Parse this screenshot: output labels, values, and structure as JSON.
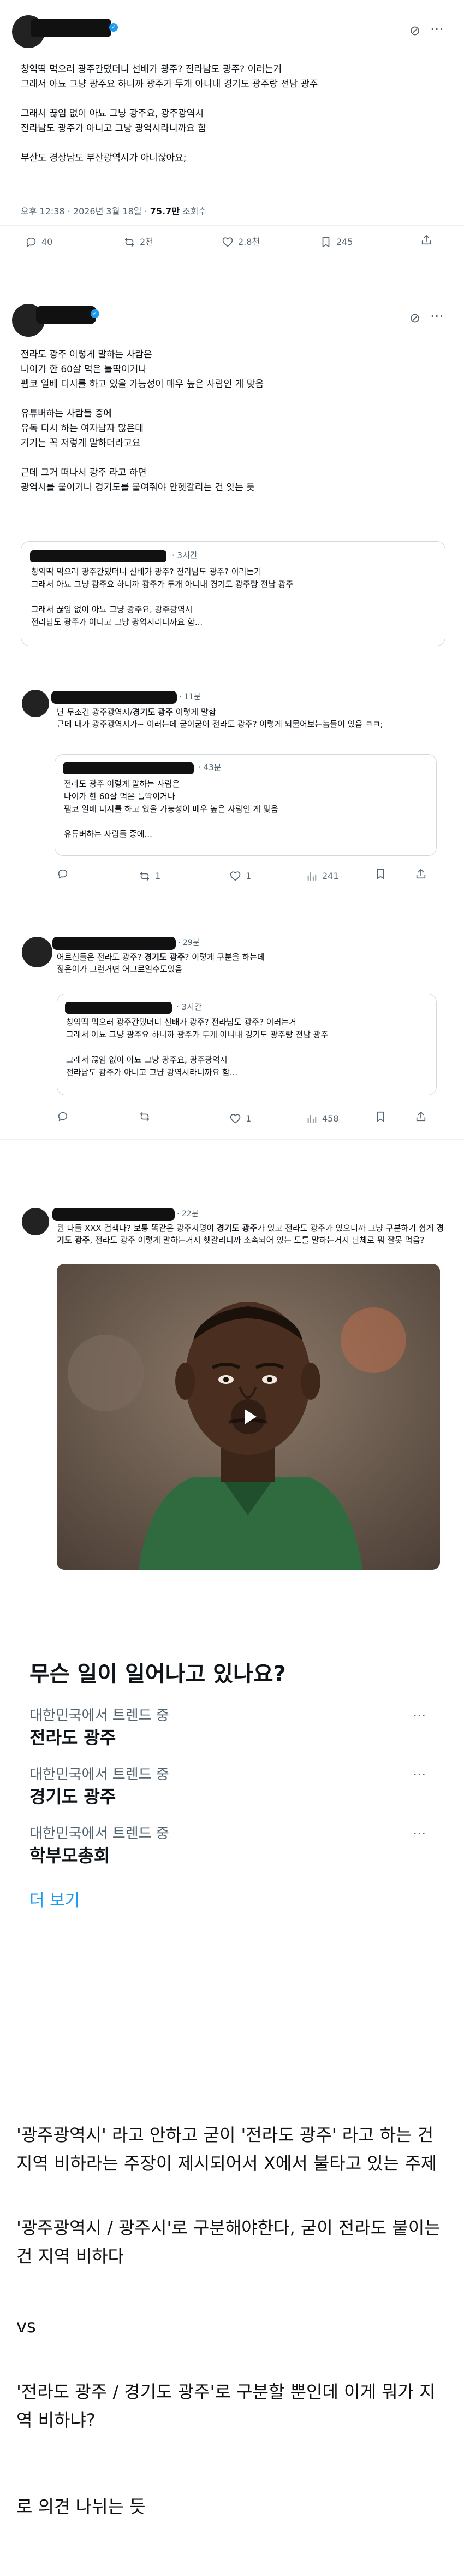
{
  "icons": {
    "grok": "grok-icon",
    "verified": "verified-badge-icon",
    "reply": "reply-icon",
    "retweet": "retweet-icon",
    "like": "like-icon",
    "stats": "stats-icon",
    "bookmark": "bookmark-icon",
    "share": "share-icon",
    "more": "more-icon",
    "play": "play-icon"
  },
  "colors": {
    "accent": "#1d9bf0",
    "muted": "#536471",
    "text": "#0f1419",
    "border": "#cfd9de"
  },
  "post1": {
    "body": "창억떡 먹으러 광주간댔더니 선배가 광주? 전라남도 광주? 이러는거\n그래서 아뇨 그냥 광주요 하니까 광주가 두개 아니내 경기도 광주랑 전남 광주\n\n그래서 끊임 없이 아뇨 그냥 광주요, 광주광역시\n전라남도 광주가 아니고 그냥 광역시라니까요 함\n\n부산도 경상남도 부산광역시가 아니잖아요;",
    "time": "오후 12:38 · 2026년 3월 18일 · ",
    "views": "75.7만",
    "views_label": " 조회수",
    "reply_count": "40",
    "retweet_count": "2천",
    "like_count": "2.8천",
    "bookmark_count": "245"
  },
  "post2": {
    "body": "전라도 광주 이렇게 말하는 사람은\n나이가 한 60살 먹은 틀딱이거나\n펨코 일베 디시를 하고 있을 가능성이 매우 높은 사람인 게 맞음\n\n유튜버하는 사람들 중에\n유독 디시 하는 여자남자 많은데\n거기는 꼭 저렇게 말하더라고요\n\n근데 그거 떠나서 광주 라고 하면\n광역시를 붙이거나 경기도를 붙여줘야 안헷갈리는 건 앗는 듯",
    "quote": {
      "time": "· 3시간",
      "text": "창억떡 먹으러 광주간댔더니 선배가 광주? 전라남도 광주? 이러는거\n그래서 아뇨 그냥 광주요 하니까 광주가 두개 아니내 경기도 광주랑 전남 광주\n\n그래서 끊임 없이 아뇨 그냥 광주요, 광주광역시\n전라남도 광주가 아니고 그냥 광역시라니까요 함..."
    }
  },
  "reply1": {
    "time": "· 11분",
    "text": "난 무조건 광주광역시/경기도 광주 이렇게 말함\n근데 내가 광주광역시가~ 이러는데 굳이굳이 전라도 광주? 이렇게 되물어보는놈들이 있음 ㅋㅋ;",
    "quote": {
      "time": "· 43분",
      "text": "전라도 광주 이렇게 말하는 사람은\n나이가 한 60살 먹은 틀딱이거나\n펨코 일베 디시를 하고 있을 가능성이 매우 높은 사람인 게 맞음\n\n유튜버하는 사람들 중에..."
    },
    "retweet_count": "1",
    "like_count": "1",
    "view_count": "241"
  },
  "reply2": {
    "time": "· 29분",
    "text": "어르신들은 전라도 광주? 경기도 광주? 이렇게 구분을 하는데\n젊은이가 그런거면 어그로일수도있음",
    "quote": {
      "time": "· 3시간",
      "text": "창억떡 먹으러 광주간댔더니 선배가 광주? 전라남도 광주? 이러는거\n그래서 아뇨 그냥 광주요 하니까 광주가 두개 아니내 경기도 광주랑 전남 광주\n\n그래서 끊임 없이 아뇨 그냥 광주요, 광주광역시\n전라남도 광주가 아니고 그냥 광역시라니까요 함..."
    },
    "like_count": "1",
    "view_count": "458"
  },
  "reply3": {
    "time": "· 22분",
    "text": "뭔 다들 XXX 검색나? 보통 똑같은 광주지명이 경기도 광주가 있고 전라도 광주가 있으니까 그냥 구분하기 쉽게 경기도 광주, 전라도 광주 이렇게 말하는거지 헷갈리니까 소속되어 있는 도를 말하는거지 단체로 뭐 잘못 먹음?"
  },
  "trends": {
    "heading": "무슨 일이 일어나고 있나요?",
    "items": [
      {
        "category": "대한민국에서 트렌드 중",
        "name": "전라도 광주"
      },
      {
        "category": "대한민국에서 트렌드 중",
        "name": "경기도 광주"
      },
      {
        "category": "대한민국에서 트렌드 중",
        "name": "학부모총회"
      }
    ],
    "more": "더 보기"
  },
  "article": {
    "p1": "'광주광역시' 라고 안하고 굳이 '전라도 광주' 라고 하는 건 지역 비하라는 주장이 제시되어서 X에서 불타고 있는 주제",
    "p2": "'광주광역시 / 광주시'로 구분해야한다, 굳이 전라도 붙이는건 지역 비하다",
    "p3": "vs",
    "p4": "'전라도 광주 / 경기도 광주'로 구분할 뿐인데 이게 뭐가 지역 비하냐?",
    "p5": "로 의견 나뉘는 듯"
  }
}
